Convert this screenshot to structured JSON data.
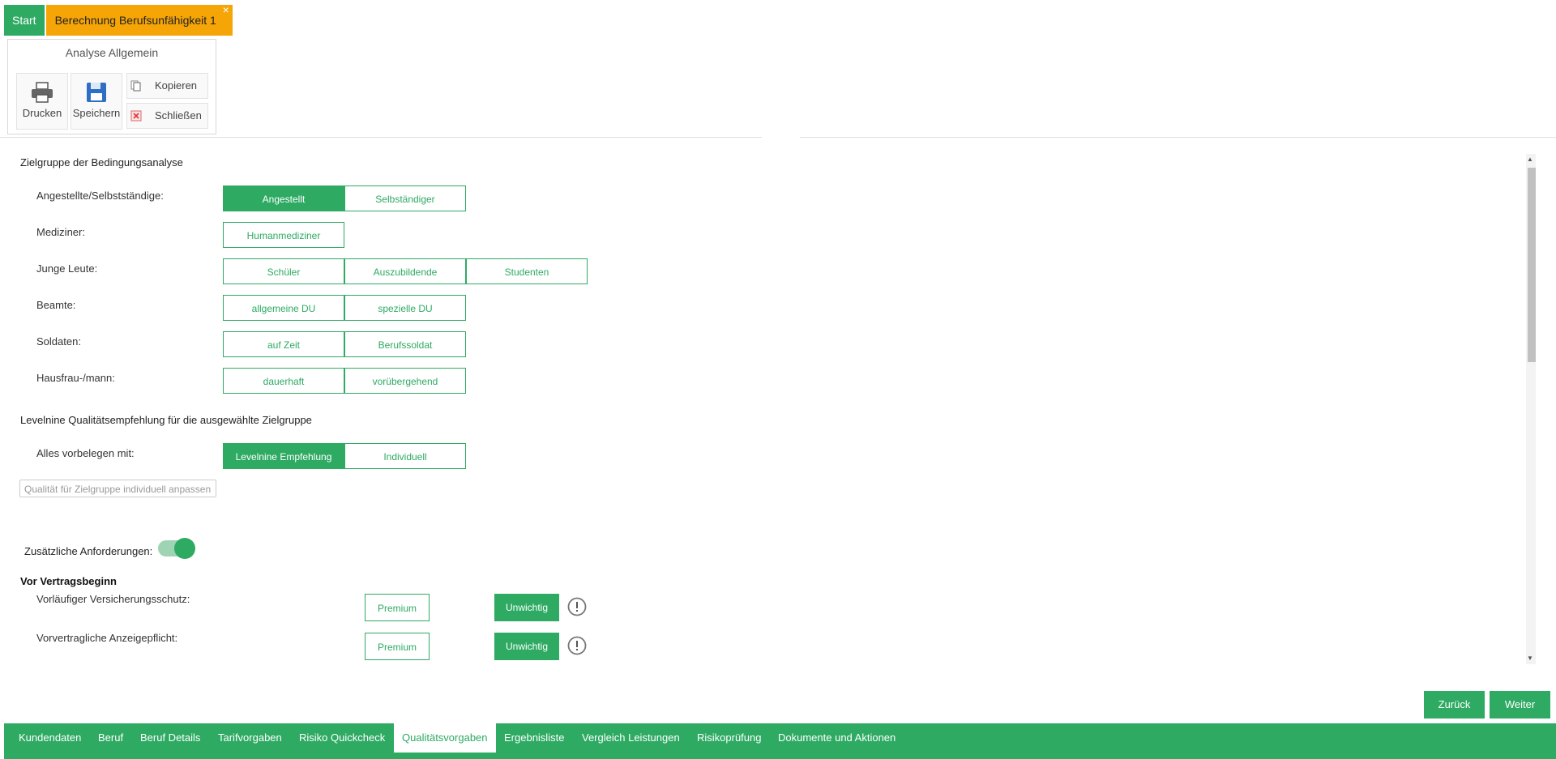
{
  "tabs": {
    "start": "Start",
    "active": "Berechnung Berufsunfähigkeit 1",
    "close": "×"
  },
  "ribbon": {
    "title": "Analyse Allgemein",
    "print": "Drucken",
    "save": "Speichern",
    "copy": "Kopieren",
    "close": "Schließen"
  },
  "zielgruppe": {
    "title": "Zielgruppe der Bedingungsanalyse",
    "rows": [
      {
        "label": "Angestellte/Selbstständige:",
        "options": [
          "Angestellt",
          "Selbständiger"
        ]
      },
      {
        "label": "Mediziner:",
        "options": [
          "Humanmediziner"
        ]
      },
      {
        "label": "Junge Leute:",
        "options": [
          "Schüler",
          "Auszubildende",
          "Studenten"
        ]
      },
      {
        "label": "Beamte:",
        "options": [
          "allgemeine DU",
          "spezielle DU"
        ]
      },
      {
        "label": "Soldaten:",
        "options": [
          "auf Zeit",
          "Berufssoldat"
        ]
      },
      {
        "label": "Hausfrau-/mann:",
        "options": [
          "dauerhaft",
          "vorübergehend"
        ]
      }
    ]
  },
  "qualitaet": {
    "title": "Levelnine Qualitätsempfehlung für die ausgewählte Zielgruppe",
    "label": "Alles vorbelegen mit:",
    "options": [
      "Levelnine Empfehlung",
      "Individuell"
    ],
    "input_placeholder": "Qualität für Zielgruppe individuell anpassen"
  },
  "zusatz": {
    "label": "Zusätzliche Anforderungen:",
    "enabled": true
  },
  "vertrag": {
    "title": "Vor Vertragsbeginn",
    "rows": [
      {
        "label": "Vorläufiger Versicherungsschutz:",
        "premium": "Premium",
        "unwichtig": "Unwichtig"
      },
      {
        "label": "Vorvertragliche Anzeigepflicht:",
        "premium": "Premium",
        "unwichtig": "Unwichtig"
      }
    ]
  },
  "nav": {
    "back": "Zurück",
    "next": "Weiter"
  },
  "bottom_tabs": [
    "Kundendaten",
    "Beruf",
    "Beruf Details",
    "Tarifvorgaben",
    "Risiko Quickcheck",
    "Qualitätsvorgaben",
    "Ergebnisliste",
    "Vergleich Leistungen",
    "Risikoprüfung",
    "Dokumente und Aktionen"
  ],
  "colors": {
    "accent": "#2eaa63",
    "tab_active": "#f5a506"
  }
}
